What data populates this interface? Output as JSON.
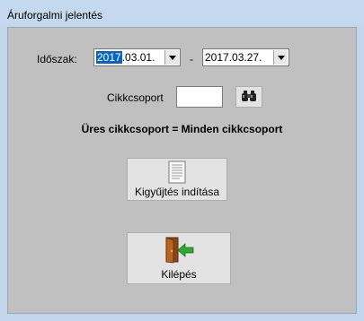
{
  "window": {
    "title": "Áruforgalmi jelentés"
  },
  "period": {
    "label": "Időszak:",
    "from_selected": "2017",
    "from_rest": ".03.01.",
    "separator": "-",
    "to_value": "2017.03.27."
  },
  "group": {
    "label": "Cikkcsoport",
    "value": "",
    "search_icon": "binoculars-icon"
  },
  "hint": "Üres cikkcsoport = Minden cikkcsoport",
  "buttons": {
    "collect_label": "Kigyűjtés indítása",
    "collect_icon": "document-icon",
    "exit_label": "Kilépés",
    "exit_icon": "exit-door-icon"
  },
  "colors": {
    "selection": "#0a64c8",
    "client_bg": "#c0c0c0",
    "frame": "#c3d7ec"
  }
}
